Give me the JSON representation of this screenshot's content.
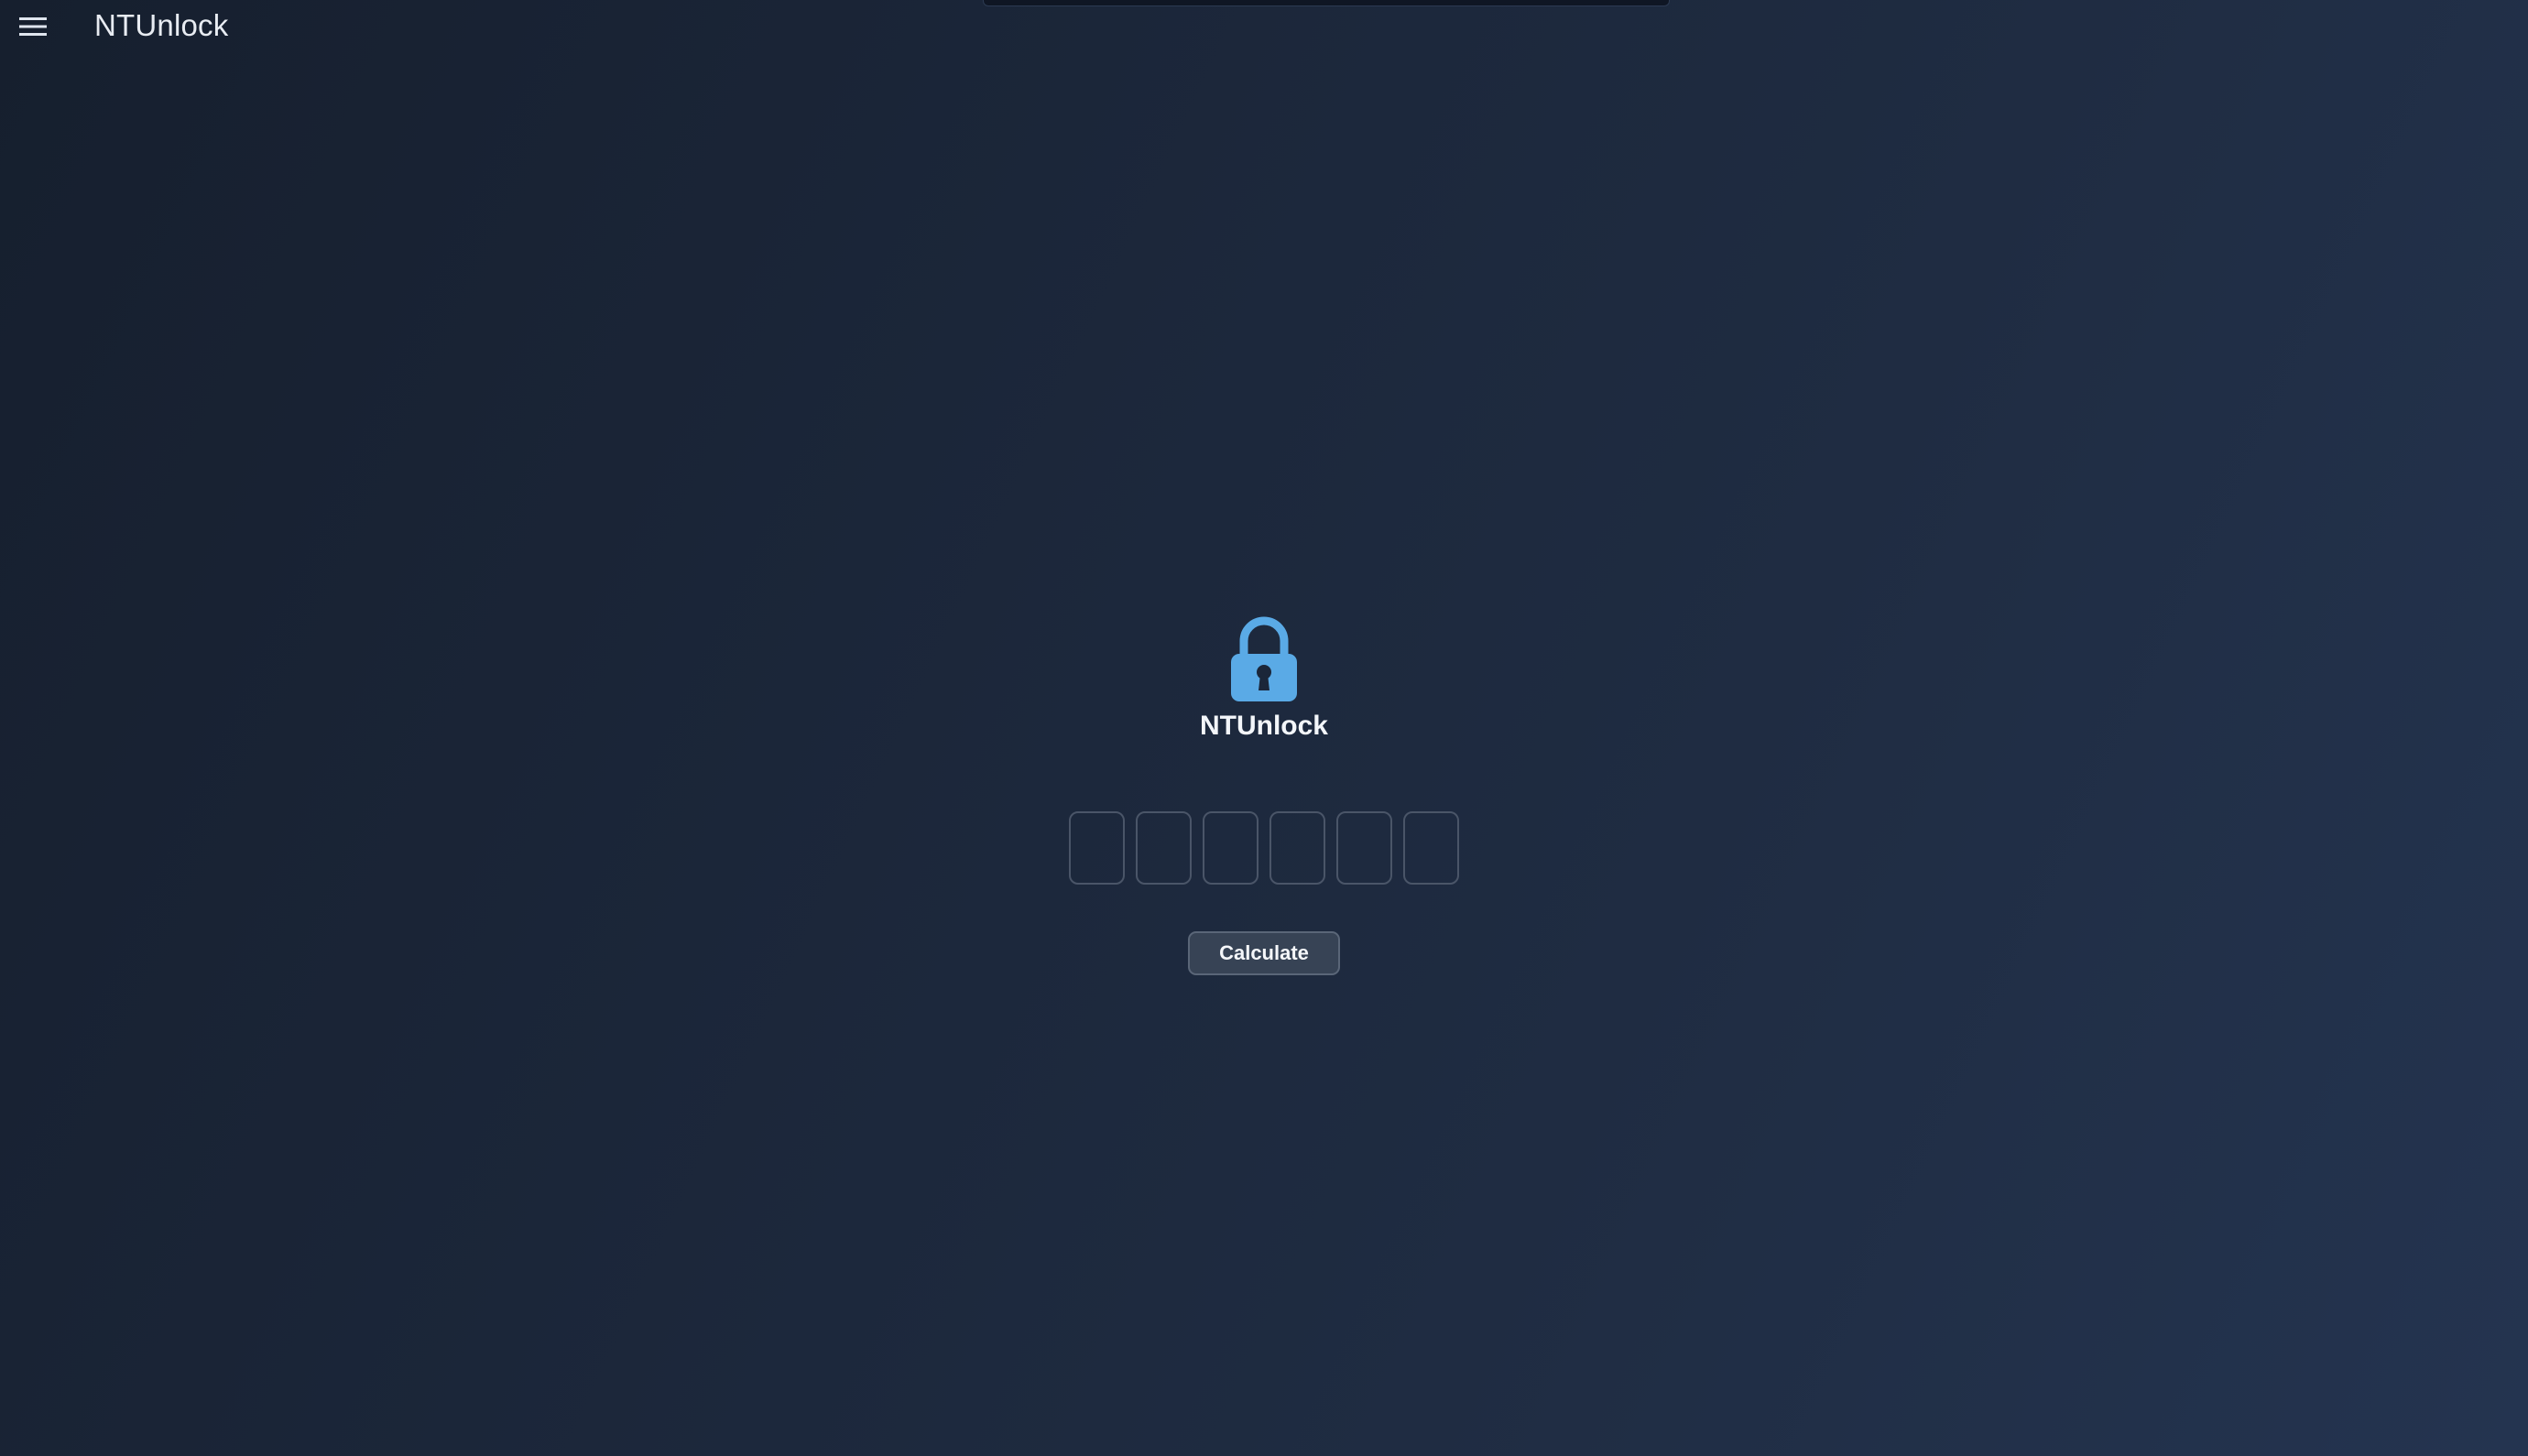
{
  "header": {
    "menu_icon": "hamburger-menu-icon",
    "title": "NTUnlock"
  },
  "main": {
    "lock_icon": "padlock-icon",
    "brand_name": "NTUnlock",
    "code_cells": [
      {
        "value": ""
      },
      {
        "value": ""
      },
      {
        "value": ""
      },
      {
        "value": ""
      },
      {
        "value": ""
      },
      {
        "value": ""
      }
    ],
    "calculate_label": "Calculate"
  },
  "colors": {
    "accent": "#5aaae6",
    "background_start": "#161f2e",
    "background_end": "#243450",
    "button_bg": "#374355",
    "cell_border": "#4a5568"
  }
}
